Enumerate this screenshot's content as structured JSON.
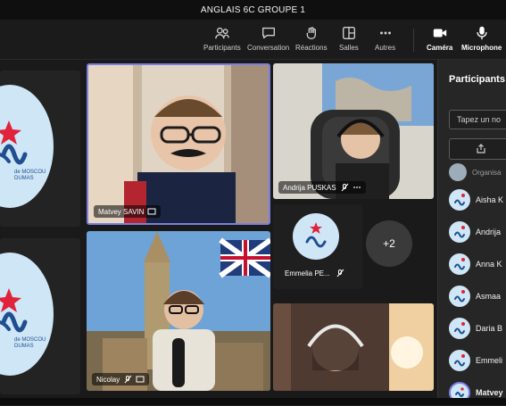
{
  "window": {
    "title": "ANGLAIS 6C GROUPE 1"
  },
  "toolbar": {
    "participants": "Participants",
    "conversation": "Conversation",
    "reactions": "Réactions",
    "rooms": "Salles",
    "more": "Autres",
    "camera": "Caméra",
    "microphone": "Microphone"
  },
  "stage": {
    "logo_left_top_lines": [
      "de MOSCOU",
      "DUMAS"
    ],
    "logo_left_bottom_lines": [
      "de MOSCOU",
      "DUMAS"
    ],
    "tiles": [
      {
        "name": "Matvey SAVIN"
      },
      {
        "name": "Andrija PUSKAS"
      },
      {
        "name": "Emmelia PE..."
      },
      {
        "name": "Nicolay"
      }
    ],
    "overflow_count": "+2"
  },
  "panel": {
    "title": "Participants",
    "search_placeholder": "Tapez un no",
    "organizer_label": "Organisa",
    "people": [
      "Aisha K",
      "Andrija",
      "Anna K",
      "Asmaa",
      "Daria B",
      "Emmeli",
      "Matvey"
    ]
  },
  "colors": {
    "accent": "#6264a7",
    "logo_bg": "#cfe6f7",
    "logo_red": "#e0233a",
    "logo_blue": "#1f4f8f"
  }
}
